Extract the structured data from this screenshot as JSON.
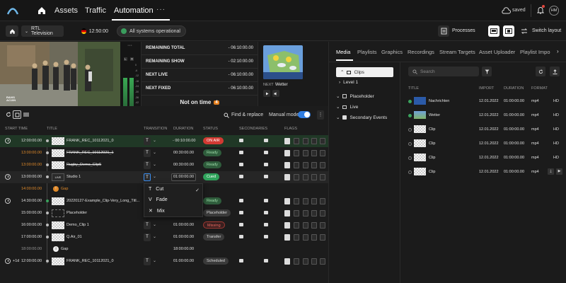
{
  "nav": {
    "items": [
      "Assets",
      "Traffic",
      "Automation"
    ],
    "more": "···",
    "saved": "saved",
    "avatar": "HM"
  },
  "toolbar": {
    "channel": "RTL Television",
    "clock": "12:50:00",
    "status": "All systems operational",
    "processes": "Processes",
    "switch_layout": "Switch layout"
  },
  "meters": {
    "labels": [
      "L",
      "R"
    ],
    "scale": [
      "0",
      "-6",
      "-12",
      "-18",
      "-24",
      "-30",
      "-36",
      "-42"
    ]
  },
  "timers": [
    {
      "label": "REMAINING TOTAL",
      "value": "- 06:10:00.00"
    },
    {
      "label": "REMAINING SHOW",
      "value": "- 02:10:00.00"
    },
    {
      "label": "NEXT LIVE",
      "value": "- 06:10:00.00"
    },
    {
      "label": "NEXT FIXED",
      "value": "- 06:10:00.00"
    }
  ],
  "ontime": {
    "text": "Not on time",
    "badge": "4"
  },
  "next": {
    "label": "NEXT",
    "title": "Wetter"
  },
  "video_logo": "RAVIS\nAC10N",
  "rundown_bar": {
    "find_replace": "Find & replace",
    "manual_mode": "Manual mode"
  },
  "columns": [
    "START TIME",
    "TITLE",
    "TRANSITION",
    "DURATION",
    "STATUS",
    "SECONDARIES",
    "FLAGS"
  ],
  "rows": [
    {
      "start": "12:00:00.00",
      "title": "FRANK_REC_10112021_0",
      "duration": "- 00:10:00.00",
      "status": "ON AIR"
    },
    {
      "start": "13:00:00.00",
      "title": "FRANK_REC_10112021_1",
      "duration": "00:30:00.00",
      "status": "Ready"
    },
    {
      "start": "13:00:00.00",
      "title": "Rugby_Demo_Clip5",
      "duration": "00:30:00.00",
      "status": "Ready"
    },
    {
      "start": "13:00:00.00",
      "title": "Studio 1",
      "live": "LIVE",
      "duration": "01:00:00.00",
      "status": "Cued"
    },
    {
      "start": "14:00:00.00",
      "title": "Gap"
    },
    {
      "start": "14:30:00.00",
      "title": "20220127-Example_Clip-Very_Long_Titl...",
      "status": "Ready"
    },
    {
      "start": "15:00:00.00",
      "title": "Placeholder",
      "status": "Placeholder"
    },
    {
      "start": "16:00:00.00",
      "title": "Demo_Clip 1",
      "duration": "01:00:00.00",
      "status": "Missing"
    },
    {
      "start": "17:00:00.00",
      "title": "Q.Air_01",
      "duration": "01:00:00.00",
      "status": "Transfer"
    },
    {
      "start": "18:00:00.00",
      "title": "Gap",
      "duration": "18:00:00.00"
    },
    {
      "start": "12:00:00.00",
      "day": "+1d",
      "title": "FRANK_REC_10112021_0",
      "duration": "01:00:00.00",
      "status": "Scheduled"
    }
  ],
  "transition_menu": [
    "Cut",
    "Fade",
    "Mix"
  ],
  "media": {
    "tabs": [
      "Media",
      "Playlists",
      "Graphics",
      "Recordings",
      "Stream Targets",
      "Asset Uploader",
      "Playlist Impo"
    ],
    "tree": {
      "clips": "Clips",
      "level1": "Level 1",
      "placeholder": "Placeholder",
      "live": "Live",
      "secondary": "Secondary Events"
    },
    "search_placeholder": "Search",
    "columns": [
      "TITLE",
      "IMPORT",
      "DURATION",
      "FORMAT"
    ],
    "items": [
      {
        "title": "Nachrichten",
        "import": "12.01.2022",
        "duration": "01:00:00.00",
        "format": "mp4",
        "res": "HD"
      },
      {
        "title": "Wetter",
        "import": "12.01.2022",
        "duration": "01:00:00.00",
        "format": "mp4",
        "res": "HD"
      },
      {
        "title": "Clip",
        "import": "12.01.2022",
        "duration": "01:00:00.00",
        "format": "mp4",
        "res": "HD"
      },
      {
        "title": "Clip",
        "import": "12.01.2022",
        "duration": "01:00:00.00",
        "format": "mp4",
        "res": "HD"
      },
      {
        "title": "Clip",
        "import": "12.01.2022",
        "duration": "01:00:00.00",
        "format": "mp4",
        "res": "HD"
      },
      {
        "title": "Clip",
        "import": "12.01.2022",
        "duration": "01:00:00.00",
        "format": "mp4",
        "res": ""
      }
    ]
  }
}
